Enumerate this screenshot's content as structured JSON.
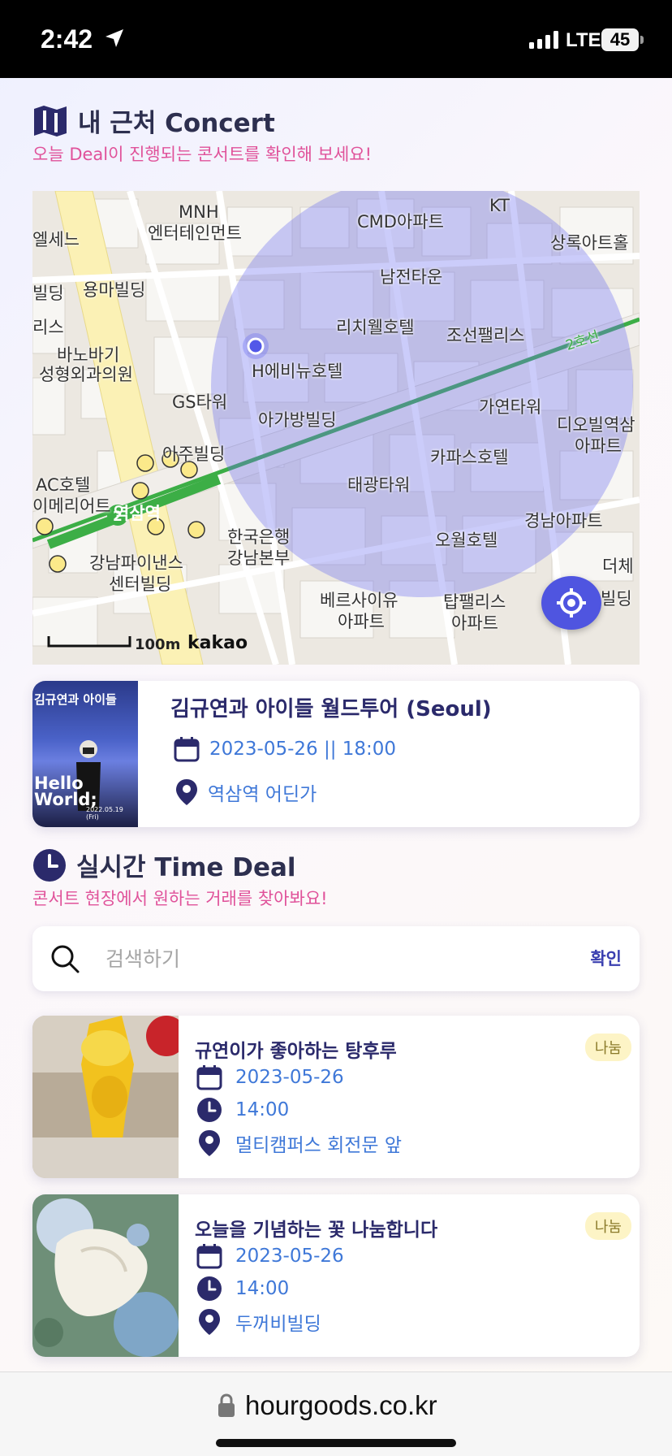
{
  "status": {
    "time": "2:42",
    "network": "LTE",
    "battery": "45"
  },
  "concert_section": {
    "title": "내 근처 Concert",
    "subtitle": "오늘 Deal이 진행되는 콘서트를 확인해 보세요!"
  },
  "map": {
    "labels": [
      "MNH",
      "엔터테인먼트",
      "CMD아파트",
      "KT",
      "상록아트홀",
      "남전타운",
      "용마빌딩",
      "빌딩",
      "리치웰호텔",
      "조선팰리스",
      "바노바기",
      "성형외과의원",
      "H에비뉴호텔",
      "GS타워",
      "아가방빌딩",
      "가연타워",
      "디오빌역삼",
      "아파트",
      "아주빌딩",
      "카파스호텔",
      "AC호텔",
      "이메리어트",
      "태광타워",
      "역삼역",
      "한국은행",
      "강남본부",
      "오월호텔",
      "경남아파트",
      "강남파이낸스",
      "센터빌딩",
      "더체",
      "베르사이유",
      "아파트",
      "탑팰리스",
      "아파트",
      "빌딩",
      "2호선",
      "엘세느",
      "리스"
    ],
    "scale": "100m",
    "brand": "kakao",
    "location_button_icon": "crosshair-icon"
  },
  "concert": {
    "thumb_caption": "김규연과 아이들",
    "thumb_hello": "Hello World;",
    "thumb_date": "2022.05.19 (Fri)",
    "title": "김규연과 아이들 월드투어 (Seoul)",
    "datetime": "2023-05-26 || 18:00",
    "location": "역삼역 어딘가"
  },
  "deal_section": {
    "title": "실시간 Time Deal",
    "subtitle": "콘서트 현장에서 원하는 거래를 찾아봐요!"
  },
  "search": {
    "placeholder": "검색하기",
    "button": "확인"
  },
  "deals": [
    {
      "title": "규연이가 좋아하는 탕후루",
      "badge": "나눔",
      "date": "2023-05-26",
      "time": "14:00",
      "location": "멀티캠퍼스 회전문 앞"
    },
    {
      "title": "오늘을 기념하는 꽃 나눔합니다",
      "badge": "나눔",
      "date": "2023-05-26",
      "time": "14:00",
      "location": "두꺼비빌딩"
    }
  ],
  "browser": {
    "url": "hourgoods.co.kr"
  },
  "colors": {
    "accent": "#4f55e0",
    "navy": "#2b2a6b",
    "pink": "#e0529a",
    "link": "#3f78d8",
    "badge_bg": "#fdf4c6"
  }
}
